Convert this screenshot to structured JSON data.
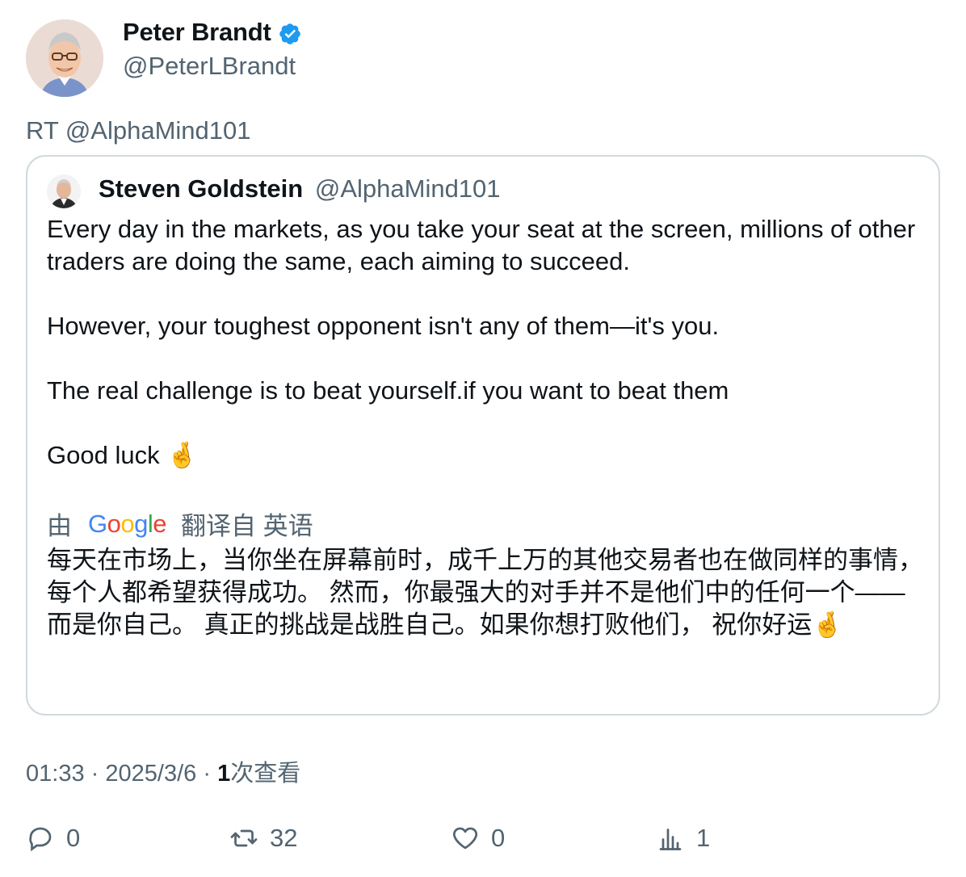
{
  "author": {
    "display_name": "Peter Brandt",
    "handle": "@PeterLBrandt",
    "verified": true
  },
  "retweet_label": "RT @AlphaMind101",
  "quoted": {
    "display_name": "Steven Goldstein",
    "handle": "@AlphaMind101",
    "paragraphs": [
      "Every day in the markets, as you take your seat at the screen, millions of other traders are doing the same, each aiming to succeed.",
      "",
      "However, your toughest opponent isn't any of them—it's you.",
      "",
      "The real challenge is to beat yourself.if you want to beat them",
      "",
      "Good luck 🤞"
    ],
    "translation": {
      "by_label": "由",
      "provider": "Google",
      "from_label": "翻译自 英语",
      "text": "每天在市场上，当你坐在屏幕前时，成千上万的其他交易者也在做同样的事情，每个人都希望获得成功。 然而，你最强大的对手并不是他们中的任何一个——而是你自己。 真正的挑战是战胜自己。如果你想打败他们， 祝你好运🤞"
    }
  },
  "meta": {
    "time": "01:33",
    "separator": "·",
    "date": "2025/3/6",
    "views_count": "1",
    "views_label": "次查看"
  },
  "actions": {
    "replies": "0",
    "retweets": "32",
    "likes": "0",
    "views": "1"
  },
  "colors": {
    "verified": "#1d9bf0",
    "secondary_text": "#536471",
    "border": "#cfd9de"
  }
}
